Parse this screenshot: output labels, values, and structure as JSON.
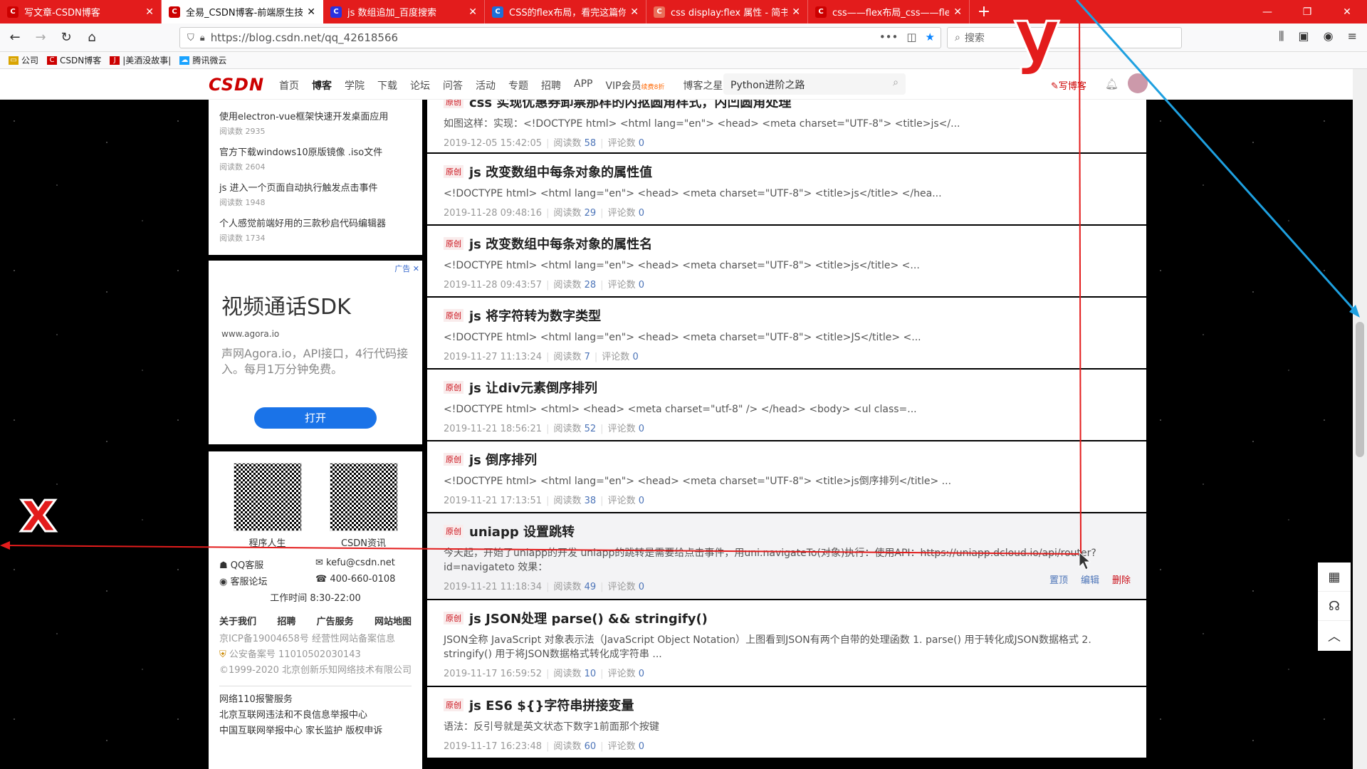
{
  "browser": {
    "tabs": [
      {
        "title": "写文章-CSDN博客",
        "icon": "csdn-icon",
        "color": "#c00"
      },
      {
        "title": "全易_CSDN博客-前端原生技术",
        "icon": "csdn-icon",
        "color": "#c00"
      },
      {
        "title": "js 数组追加_百度搜索",
        "icon": "baidu-icon",
        "color": "#2932e1"
      },
      {
        "title": "CSS的flex布局，看完这篇你就",
        "icon": "image-icon",
        "color": "#1e6fd9"
      },
      {
        "title": "css display:flex 属性 - 简书",
        "icon": "jianshu-icon",
        "color": "#ea6f5a"
      },
      {
        "title": "css——flex布局_css——flex布",
        "icon": "csdn-icon",
        "color": "#c00"
      }
    ],
    "url": "https://blog.csdn.net/qq_42618566",
    "search_placeholder": "搜索",
    "bookmarks": [
      "公司",
      "CSDN博客",
      "|美酒没故事|",
      "腾讯微云"
    ]
  },
  "csdn_header": {
    "logo": "CSDN",
    "nav": [
      "首页",
      "博客",
      "学院",
      "下载",
      "论坛",
      "问答",
      "活动",
      "专题",
      "招聘",
      "APP"
    ],
    "vip": "VIP会员",
    "vip_tag": "续费8折",
    "star": "博客之星",
    "search_value": "Python进阶之路",
    "write": "写博客"
  },
  "sidebar": {
    "popular": [
      {
        "title": "使用electron-vue框架快速开发桌面应用",
        "reads": "阅读数 2935"
      },
      {
        "title": "官方下载windows10原版镜像 .iso文件",
        "reads": "阅读数 2604"
      },
      {
        "title": "js 进入一个页面自动执行触发点击事件",
        "reads": "阅读数 1948"
      },
      {
        "title": "个人感觉前端好用的三款秒启代码编辑器",
        "reads": "阅读数 1734"
      }
    ],
    "ad": {
      "tag": "广告",
      "title": "视频通话SDK",
      "url": "www.agora.io",
      "desc": "声网Agora.io，API接口，4行代码接入。每月1万分钟免费。",
      "button": "打开"
    },
    "qr": [
      "程序人生",
      "CSDN资讯"
    ],
    "contact": {
      "qq": "QQ客服",
      "email": "kefu@csdn.net",
      "forum": "客服论坛",
      "phone": "400-660-0108",
      "hours": "工作时间 8:30-22:00"
    },
    "links": [
      "关于我们",
      "招聘",
      "广告服务",
      "网站地图"
    ],
    "legal": [
      "京ICP备19004658号 经营性网站备案信息",
      "公安备案号 11010502030143",
      "©1999-2020 北京创新乐知网络技术有限公司"
    ],
    "legal2": [
      "网络110报警服务",
      "北京互联网违法和不良信息举报中心",
      "中国互联网举报中心 家长监护 版权申诉"
    ]
  },
  "posts": [
    {
      "badge": "原创",
      "title": "css 实现优惠券卸票那样的内抠圆角样式，内凹圆角处理",
      "excerpt": "如图这样：实现：<!DOCTYPE html> <html lang=\"en\"> <head> <meta charset=\"UTF-8\"> <title>js</...",
      "date": "2019-12-05 15:42:05",
      "reads": "58",
      "comments": "0"
    },
    {
      "badge": "原创",
      "title": "js 改变数组中每条对象的属性值",
      "excerpt": "<!DOCTYPE html> <html lang=\"en\"> <head> <meta charset=\"UTF-8\"> <title>js</title> </hea...",
      "date": "2019-11-28 09:48:16",
      "reads": "29",
      "comments": "0"
    },
    {
      "badge": "原创",
      "title": "js 改变数组中每条对象的属性名",
      "excerpt": "<!DOCTYPE html> <html lang=\"en\"> <head> <meta charset=\"UTF-8\"> <title>js</title> <...",
      "date": "2019-11-28 09:43:57",
      "reads": "28",
      "comments": "0"
    },
    {
      "badge": "原创",
      "title": "js 将字符转为数字类型",
      "excerpt": "<!DOCTYPE html> <html lang=\"en\"> <head> <meta charset=\"UTF-8\"> <title>JS</title> <...",
      "date": "2019-11-27 11:13:24",
      "reads": "7",
      "comments": "0"
    },
    {
      "badge": "原创",
      "title": "js 让div元素倒序排列",
      "excerpt": "<!DOCTYPE html> <html> <head> <meta charset=\"utf-8\" /> </head> <body> <ul class=...",
      "date": "2019-11-21 18:56:21",
      "reads": "52",
      "comments": "0"
    },
    {
      "badge": "原创",
      "title": "js 倒序排列",
      "excerpt": "<!DOCTYPE html> <html lang=\"en\"> <head> <meta charset=\"UTF-8\"> <title>js倒序排列</title> ...",
      "date": "2019-11-21 17:13:51",
      "reads": "38",
      "comments": "0"
    },
    {
      "badge": "原创",
      "title": "uniapp 设置跳转",
      "excerpt": "今天起，开始了uniapp的开发 uniapp的跳转是需要给点击事件，用uni.navigateTo(对象)执行：使用API：https://uniapp.dcloud.io/api/router?id=navigateto 效果：",
      "date": "2019-11-21 11:18:34",
      "reads": "49",
      "comments": "0"
    },
    {
      "badge": "原创",
      "title": "js JSON处理 parse() && stringify()",
      "excerpt": "JSON全称 JavaScript 对象表示法（JavaScript Object Notation）上图看到JSON有两个自带的处理函数 1. parse() 用于转化成JSON数据格式 2. stringify() 用于将JSON数据格式转化成字符串 ...",
      "date": "2019-11-17 16:59:52",
      "reads": "10",
      "comments": "0"
    },
    {
      "badge": "原创",
      "title": "js ES6 ${}字符串拼接变量",
      "excerpt": "语法：反引号就是英文状态下数字1前面那个按键",
      "date": "2019-11-17 16:23:48",
      "reads": "60",
      "comments": "0"
    }
  ],
  "labels": {
    "reads": "阅读数",
    "comments": "评论数"
  },
  "post_actions": [
    "置顶",
    "编辑",
    "删除"
  ],
  "annotations": {
    "x": "x",
    "y": "y"
  }
}
